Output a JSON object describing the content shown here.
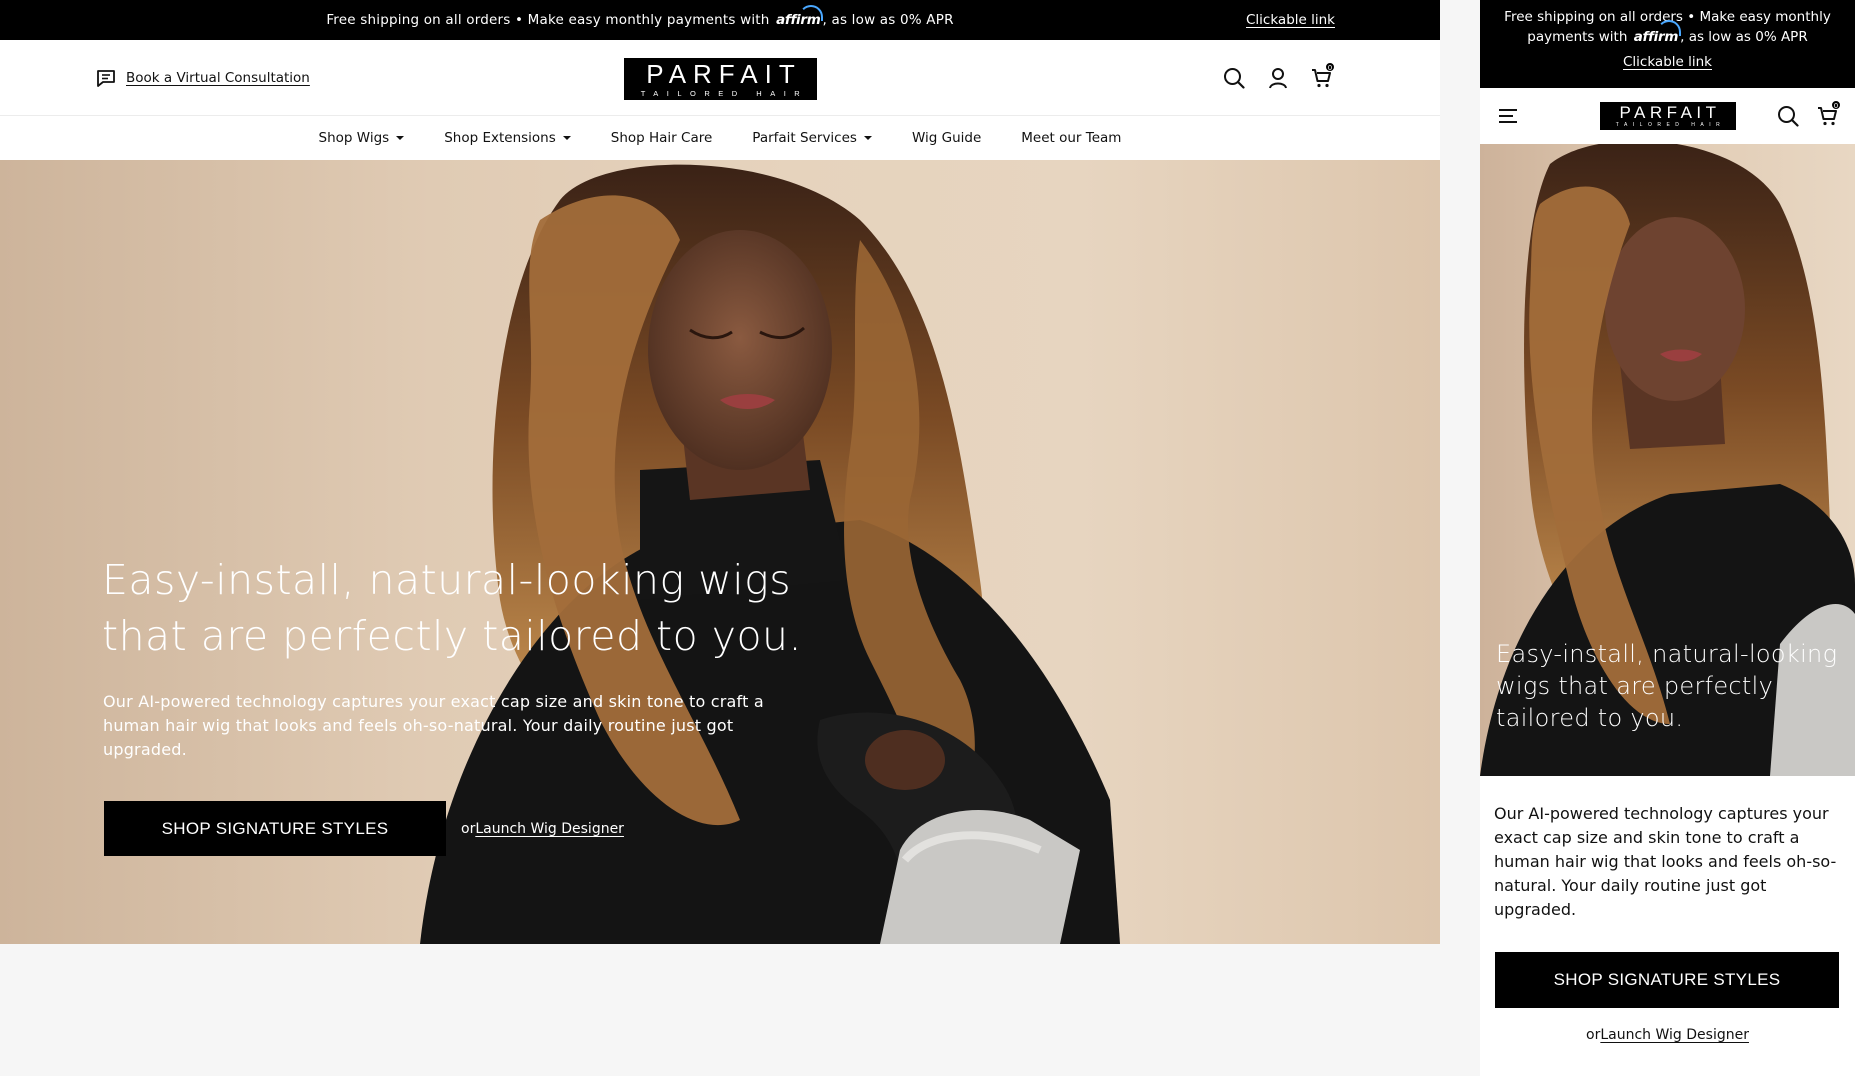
{
  "promo": {
    "text_before": "Free shipping on all orders • Make easy monthly payments with",
    "affirm": "affirm",
    "text_after": ", as low as 0% APR",
    "link": "Clickable link"
  },
  "header": {
    "consult_label": "Book a Virtual Consultation",
    "logo_word": "PARFAIT",
    "logo_sub": "TAILORED HAIR",
    "cart_count": "0"
  },
  "nav": {
    "items": [
      {
        "label": "Shop Wigs",
        "dropdown": true
      },
      {
        "label": "Shop Extensions",
        "dropdown": true
      },
      {
        "label": "Shop Hair Care",
        "dropdown": false
      },
      {
        "label": "Parfait Services",
        "dropdown": true
      },
      {
        "label": "Wig Guide",
        "dropdown": false
      },
      {
        "label": "Meet our Team",
        "dropdown": false
      }
    ]
  },
  "hero": {
    "headline_line1": "Easy-install, natural-looking wigs",
    "headline_line2": "that are perfectly tailored to you.",
    "headline": "Easy-install, natural-looking wigs that are perfectly tailored to you.",
    "body": "Our AI-powered technology captures your exact cap size and skin tone to craft a human hair wig that looks and feels oh-so-natural. Your daily routine just got upgraded.",
    "cta": "SHOP SIGNATURE STYLES",
    "alt_prefix": "or",
    "alt_link": "Launch Wig Designer"
  },
  "mobile": {
    "promo_text": "Free shipping on all orders • Make easy monthly payments with",
    "promo_link": "Clickable link"
  },
  "colors": {
    "promo_bg": "#000000",
    "accent_affirm": "#4aa8ff",
    "cta_bg": "#000000",
    "page_bg": "#f6f6f6"
  },
  "icons": [
    "chat-icon",
    "search-icon",
    "account-icon",
    "cart-icon",
    "menu-icon",
    "caret-down-icon"
  ]
}
